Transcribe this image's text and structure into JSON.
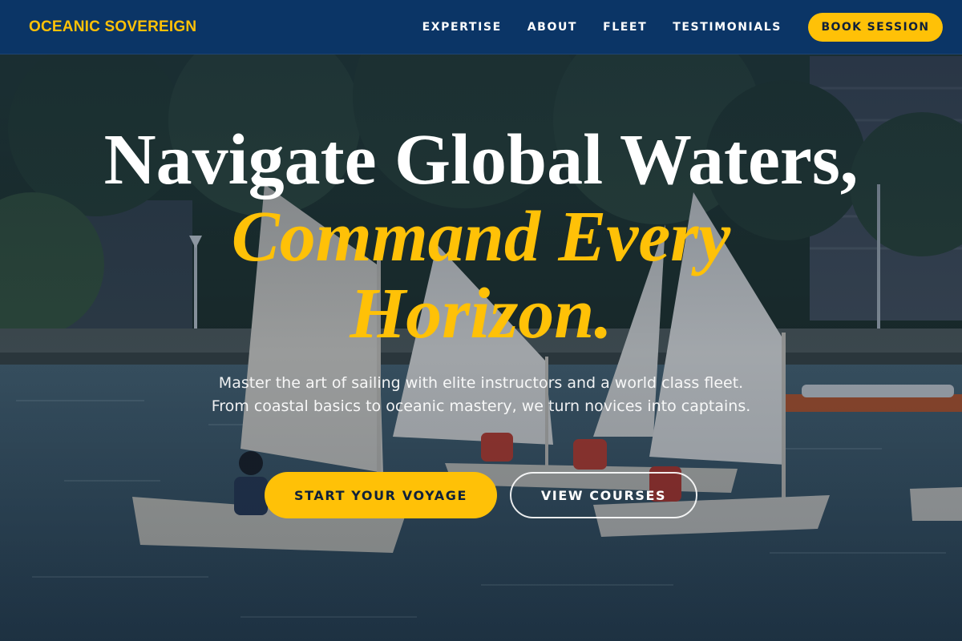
{
  "colors": {
    "accent": "#ffc107",
    "navbar": "#0b3566",
    "text_light": "#ffffff",
    "button_text": "#10213a"
  },
  "nav": {
    "brand": "OCEANIC SOVEREIGN",
    "links": [
      "EXPERTISE",
      "ABOUT",
      "FLEET",
      "TESTIMONIALS"
    ],
    "cta": "BOOK SESSION"
  },
  "hero": {
    "headline_line1": "Navigate Global Waters,",
    "headline_line2": "Command Every",
    "headline_line3": "Horizon.",
    "subtitle": "Master the art of sailing with elite instructors and a world class fleet. From coastal basics to oceanic mastery, we turn novices into captains.",
    "primary_button": "START YOUR VOYAGE",
    "secondary_button": "VIEW COURSES",
    "background": "photo-sailing-dinghies-with-young-sailors-on-harbor"
  }
}
